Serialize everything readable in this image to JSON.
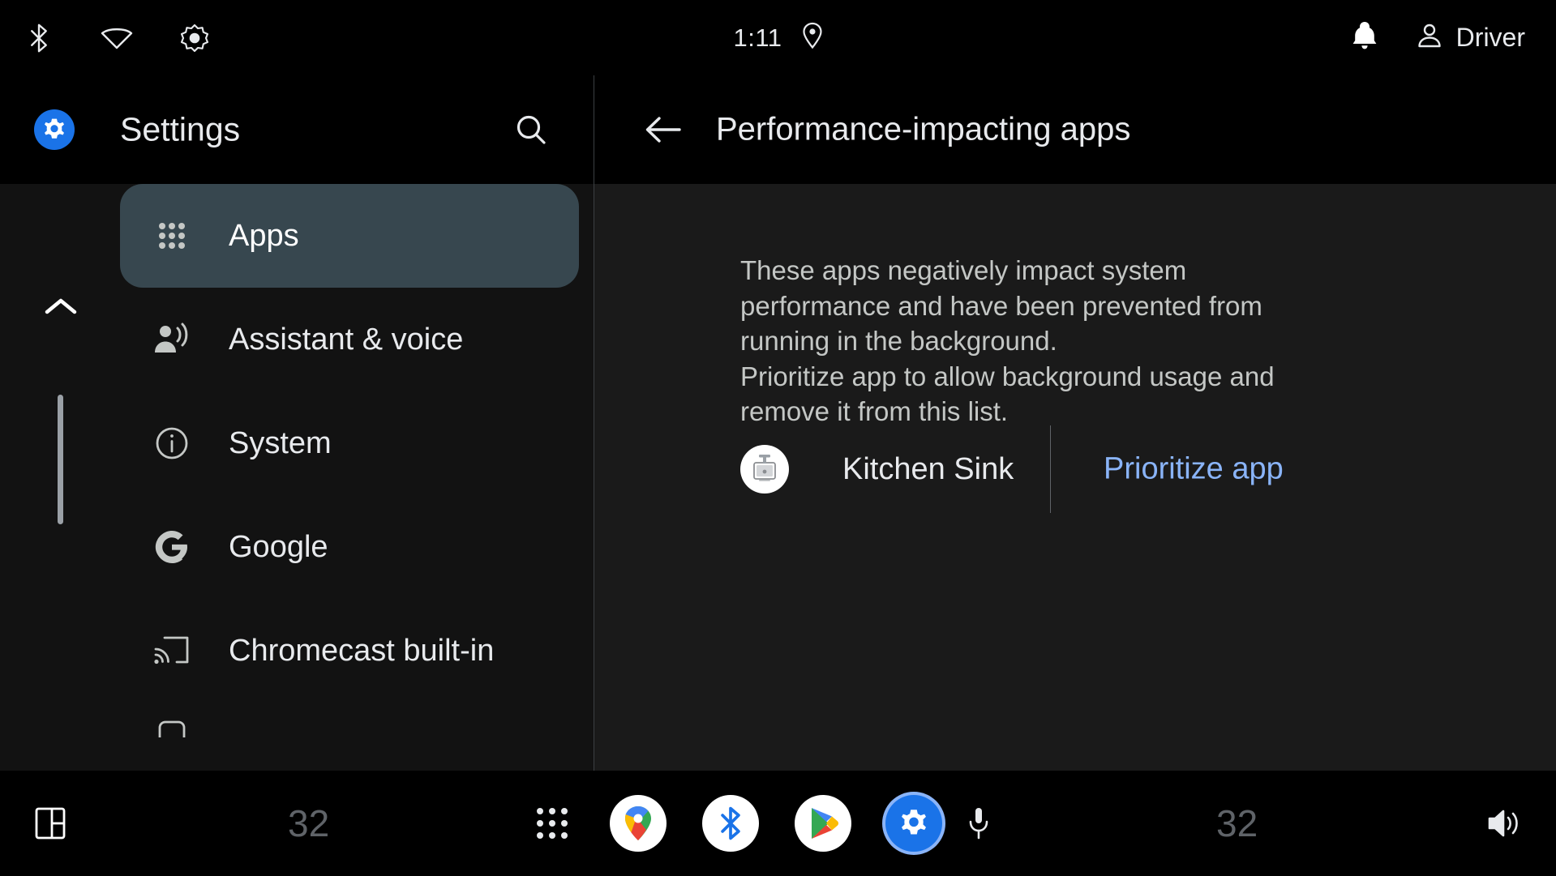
{
  "statusbar": {
    "icons_left": [
      {
        "name": "bluetooth-icon"
      },
      {
        "name": "wifi-icon"
      },
      {
        "name": "brightness-icon"
      }
    ],
    "time": "1:11",
    "location_icon": "location-pin-icon",
    "notification_icon": "notification-bell-icon",
    "user_icon": "person-icon",
    "user_name": "Driver"
  },
  "sidebar": {
    "title": "Settings",
    "app_icon": "settings-gear-icon",
    "search_icon": "search-icon",
    "scroll_up_icon": "chevron-up-icon",
    "scroll_down_icon": "chevron-down-icon",
    "items": [
      {
        "label": "Apps",
        "icon": "apps-grid-icon",
        "selected": true
      },
      {
        "label": "Assistant & voice",
        "icon": "assistant-voice-icon",
        "selected": false
      },
      {
        "label": "System",
        "icon": "info-circle-icon",
        "selected": false
      },
      {
        "label": "Google",
        "icon": "google-g-icon",
        "selected": false
      },
      {
        "label": "Chromecast built-in",
        "icon": "cast-icon",
        "selected": false
      }
    ]
  },
  "detail": {
    "back_icon": "back-arrow-icon",
    "title": "Performance-impacting apps",
    "description_lines": [
      "These apps negatively impact system",
      "performance and have been prevented from",
      "running in the background.",
      "Prioritize app to allow background usage and",
      "remove it from this list."
    ],
    "app_row": {
      "icon": "kitchen-sink-app-icon",
      "name": "Kitchen Sink",
      "action_label": "Prioritize app"
    }
  },
  "navbar": {
    "panel_icon": "split-screen-icon",
    "temp_left": "32",
    "launcher_icon": "apps-grid-icon",
    "maps_icon": "google-maps-icon",
    "bluetooth_icon": "bluetooth-icon",
    "playstore_icon": "google-play-icon",
    "settings_icon": "settings-gear-icon",
    "mic_icon": "microphone-icon",
    "temp_right": "32",
    "volume_icon": "volume-icon"
  },
  "colors": {
    "accent_blue": "#1a73e8",
    "link_blue": "#8ab4f8",
    "selected_nav": "#37474f",
    "background": "#000000",
    "panel_bg": "#1a1a1a",
    "sidebar_bg": "#121212"
  }
}
